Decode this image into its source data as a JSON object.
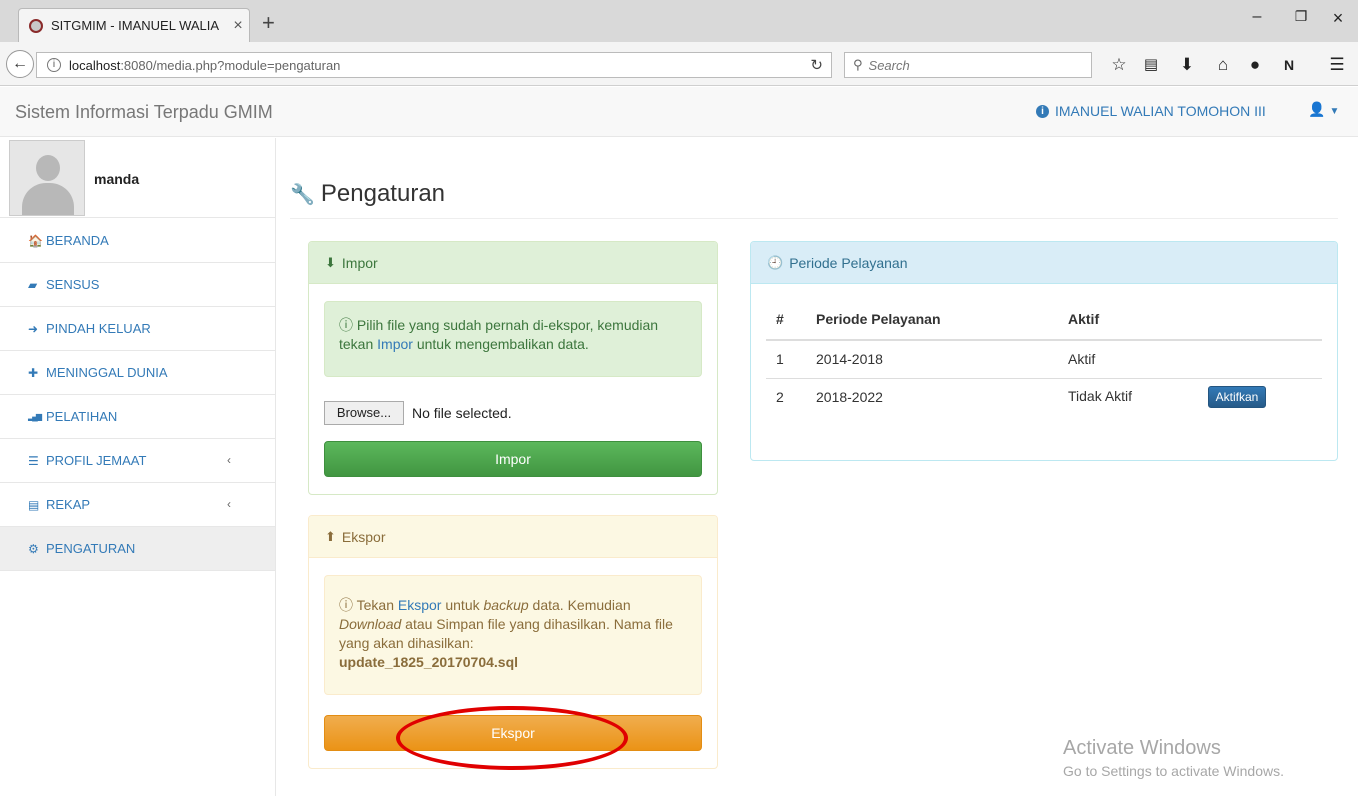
{
  "browser": {
    "tab_title": "SITGMIM - IMANUEL WALIA",
    "tab_close": "×",
    "new_tab": "+",
    "min": "–",
    "max": "❐",
    "close": "×",
    "url_host": "localhost",
    "url_path": ":8080/media.php?module=pengaturan",
    "search_placeholder": "Search"
  },
  "header": {
    "brand": "Sistem Informasi Terpadu GMIM",
    "church": "IMANUEL WALIAN TOMOHON III"
  },
  "sidebar": {
    "username": "manda",
    "items": [
      {
        "label": "BERANDA",
        "icon": "home-icon",
        "glyph": "🏠"
      },
      {
        "label": "SENSUS",
        "icon": "book-icon",
        "glyph": "▰"
      },
      {
        "label": "PINDAH KELUAR",
        "icon": "sign-out-icon",
        "glyph": "➜"
      },
      {
        "label": "MENINGGAL DUNIA",
        "icon": "plus-icon",
        "glyph": "✚"
      },
      {
        "label": "PELATIHAN",
        "icon": "signal-icon",
        "glyph": "▂▄▆"
      },
      {
        "label": "PROFIL JEMAAT",
        "icon": "list-icon",
        "glyph": "☰"
      },
      {
        "label": "REKAP",
        "icon": "file-icon",
        "glyph": "▤"
      },
      {
        "label": "PENGATURAN",
        "icon": "cogs-icon",
        "glyph": "⚙"
      }
    ]
  },
  "main": {
    "title": "Pengaturan",
    "impor": {
      "heading": "Impor",
      "alert_a": "Pilih file yang sudah pernah di-ekspor, kemudian tekan ",
      "alert_link": "Impor",
      "alert_b": " untuk mengembalikan data.",
      "browse": "Browse...",
      "no_file": "No file selected.",
      "button": "Impor"
    },
    "ekspor": {
      "heading": "Ekspor",
      "alert_a": "Tekan ",
      "alert_link": "Ekspor",
      "alert_b": " untuk ",
      "alert_em1": "backup",
      "alert_c": " data. Kemudian ",
      "alert_em2": "Download",
      "alert_d": " atau Simpan file yang dihasilkan. Nama file yang akan dihasilkan:",
      "filename": "update_1825_20170704.sql",
      "button": "Ekspor"
    },
    "periode": {
      "heading": "Periode Pelayanan",
      "columns": [
        "#",
        "Periode Pelayanan",
        "Aktif"
      ],
      "rows": [
        {
          "no": "1",
          "periode": "2014-2018",
          "status": "Aktif"
        },
        {
          "no": "2",
          "periode": "2018-2022",
          "status": "Tidak Aktif",
          "action": "Aktifkan"
        }
      ]
    }
  },
  "watermark": {
    "line1": "Activate Windows",
    "line2": "Go to Settings to activate Windows."
  },
  "colors": {
    "link": "#337ab7",
    "success": "#5cb85c",
    "warning": "#f0ad4e",
    "annotation": "#e00000"
  }
}
